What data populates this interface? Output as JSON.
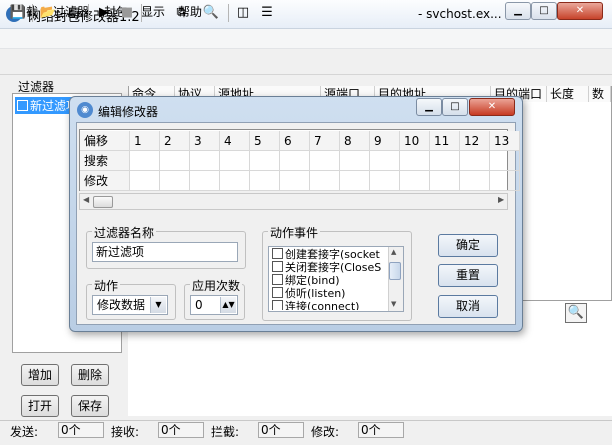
{
  "window": {
    "title": "网络封包修改器1.2",
    "subtitle": "- svchost.ex..."
  },
  "menu": [
    "网截",
    "过滤器",
    "封包",
    "显示",
    "帮助"
  ],
  "filters": {
    "label": "过滤器",
    "items": [
      "新过滤项"
    ]
  },
  "left_buttons": {
    "add": "增加",
    "delete": "删除",
    "open": "打开",
    "save": "保存"
  },
  "packet_columns": [
    "命令",
    "协议",
    "源地址",
    "源端口",
    "目的地址",
    "目的端口",
    "长度",
    "数"
  ],
  "statusbar": [
    {
      "label": "发送:",
      "value": "0个"
    },
    {
      "label": "接收:",
      "value": "0个"
    },
    {
      "label": "拦截:",
      "value": "0个"
    },
    {
      "label": "修改:",
      "value": "0个"
    }
  ],
  "dialog": {
    "title": "编辑修改器",
    "grid": {
      "columns": [
        "偏移",
        "1",
        "2",
        "3",
        "4",
        "5",
        "6",
        "7",
        "8",
        "9",
        "10",
        "11",
        "12",
        "13"
      ],
      "rows": [
        "搜索",
        "修改"
      ]
    },
    "filter_name_label": "过滤器名称",
    "filter_name_value": "新过滤项",
    "action_label": "动作",
    "action_value": "修改数据",
    "apply_count_label": "应用次数",
    "apply_count_value": "0",
    "events_label": "动作事件",
    "events": [
      "创建套接字(socket",
      "关闭套接字(CloseS",
      "绑定(bind)",
      "侦听(listen)",
      "连接(connect)"
    ],
    "ok": "确定",
    "reset": "重置",
    "cancel": "取消"
  }
}
